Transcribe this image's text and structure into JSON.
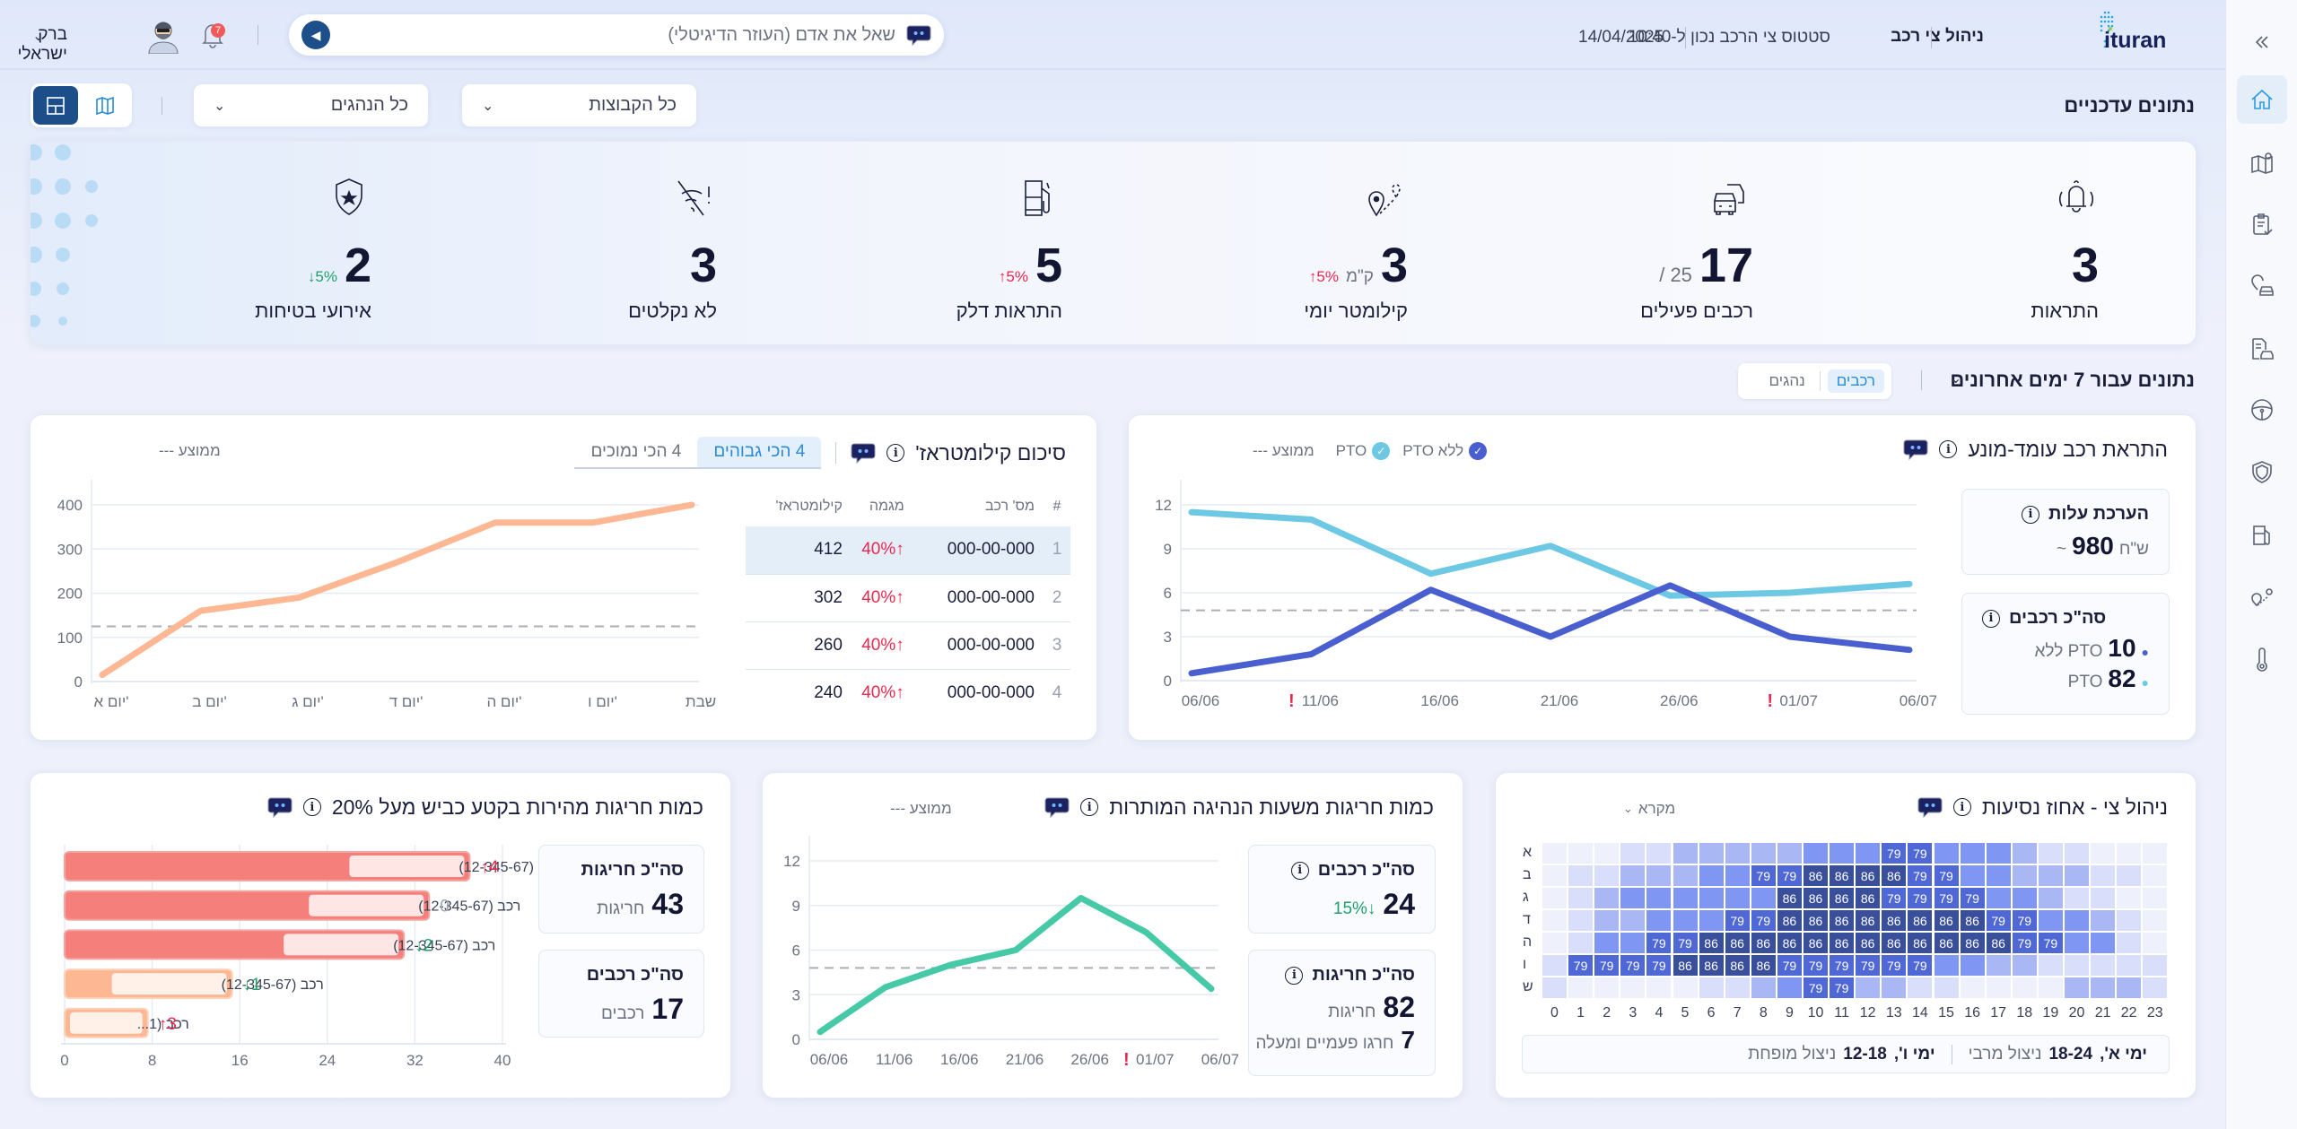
{
  "header": {
    "brand": "ituran",
    "app_title": "ניהול צי רכב",
    "status_text": "סטטוס צי הרכב נכון ל-10:40",
    "date": "14/04/2025",
    "search_placeholder": "שאל את אדם (העוזר הדיגיטלי)",
    "user_name": "ברק ישראלי",
    "notifications_count": "7"
  },
  "sidebar": {
    "items": [
      {
        "id": "collapse",
        "icon": "chevrons-left-icon"
      },
      {
        "id": "home",
        "icon": "home-icon",
        "active": true
      },
      {
        "id": "map",
        "icon": "map-pin-icon"
      },
      {
        "id": "reports",
        "icon": "clipboard-check-icon"
      },
      {
        "id": "vehicle-location",
        "icon": "car-location-icon"
      },
      {
        "id": "vehicle-docs",
        "icon": "car-document-icon"
      },
      {
        "id": "driving",
        "icon": "steering-wheel-icon"
      },
      {
        "id": "safety",
        "icon": "shield-icon"
      },
      {
        "id": "fuel",
        "icon": "fuel-pump-icon"
      },
      {
        "id": "routes",
        "icon": "route-icon"
      },
      {
        "id": "temperature",
        "icon": "thermometer-icon"
      }
    ]
  },
  "filters": {
    "section_title": "נתונים עדכניים",
    "groups": "כל הקבוצות",
    "drivers": "כל הנהגים",
    "view_modes": [
      "map",
      "dashboard"
    ],
    "active_view": "dashboard"
  },
  "kpis": [
    {
      "label": "התראות",
      "value": "3",
      "icon": "bell-icon"
    },
    {
      "label": "רכבים פעילים",
      "value": "17",
      "sub": "/ 25",
      "icon": "cars-icon"
    },
    {
      "label": "קילומטר יומי",
      "value": "3",
      "unit": "ק\"מ",
      "trend": "↑5%",
      "trend_dir": "up",
      "icon": "route-pin-icon"
    },
    {
      "label": "התראות דלק",
      "value": "5",
      "trend": "↑5%",
      "trend_dir": "up",
      "icon": "fuel-pump-icon"
    },
    {
      "label": "לא נקלטים",
      "value": "3",
      "icon": "no-signal-icon"
    },
    {
      "label": "אירועי בטיחות",
      "value": "2",
      "trend": "↓5%",
      "trend_dir": "down",
      "icon": "shield-star-icon"
    }
  ],
  "period": {
    "title": "נתונים עבור 7 ימים אחרונים",
    "tabs": [
      "רכבים",
      "נהגים"
    ],
    "active_tab": "רכבים"
  },
  "mileage": {
    "title": "סיכום קילומטראז'",
    "tabs": [
      "4 הכי גבוהים",
      "4 הכי נמוכים"
    ],
    "active_tab": "4 הכי גבוהים",
    "avg_label": "ממוצע ---",
    "table": {
      "headers": [
        "#",
        "מס' רכב",
        "מגמה",
        "קילומטראז'"
      ],
      "rows": [
        {
          "rank": "1",
          "plate": "000-00-000",
          "trend": "↑40%",
          "km": "412"
        },
        {
          "rank": "2",
          "plate": "000-00-000",
          "trend": "↑40%",
          "km": "302"
        },
        {
          "rank": "3",
          "plate": "000-00-000",
          "trend": "↑40%",
          "km": "260"
        },
        {
          "rank": "4",
          "plate": "000-00-000",
          "trend": "↑40%",
          "km": "240"
        }
      ]
    },
    "chart_data": {
      "type": "line",
      "categories": [
        "יום א'",
        "יום ב'",
        "יום ג'",
        "יום ד'",
        "יום ה'",
        "יום ו'",
        "שבת"
      ],
      "values": [
        15,
        160,
        190,
        270,
        360,
        360,
        400
      ],
      "average": 125,
      "ylim": [
        0,
        400
      ],
      "yticks": [
        0,
        100,
        200,
        300,
        400
      ],
      "color": "#fdb893",
      "grid": true
    }
  },
  "idle": {
    "title": "התראת רכב עומד-מונע",
    "legend": [
      {
        "label": "ללא PTO",
        "color": "#4a5fcf"
      },
      {
        "label": "PTO",
        "color": "#6cc8e3"
      }
    ],
    "avg_label": "ממוצע ---",
    "cost": {
      "title": "הערכת עלות",
      "prefix": "~",
      "value": "980",
      "unit": "ש\"ח"
    },
    "vehicles": {
      "title": "סה\"כ רכבים",
      "rows": [
        {
          "value": "10",
          "label": "ללא PTO"
        },
        {
          "value": "82",
          "label": "PTO"
        }
      ]
    },
    "chart_data": {
      "type": "line",
      "categories": [
        "06/06",
        "11/06",
        "16/06",
        "21/06",
        "26/06",
        "01/07",
        "06/07"
      ],
      "alerts": [
        "11/06",
        "01/07"
      ],
      "series": [
        {
          "name": "ללא PTO",
          "color": "#4a5fcf",
          "values": [
            0.5,
            1.8,
            6.2,
            3.0,
            6.5,
            3.0,
            2.1
          ]
        },
        {
          "name": "PTO",
          "color": "#6cc8e3",
          "values": [
            11.5,
            11.0,
            7.3,
            9.2,
            5.8,
            6.0,
            6.6
          ]
        }
      ],
      "average": 4.8,
      "ylim": [
        0,
        12
      ],
      "yticks": [
        0,
        3,
        6,
        9,
        12
      ],
      "grid": true
    }
  },
  "speeding": {
    "title": "כמות חריגות מהירות בקטע כביש מעל 20%",
    "total_violations": {
      "title": "סה\"כ חריגות",
      "value": "43",
      "unit": "חריגות"
    },
    "total_vehicles": {
      "title": "סה\"כ רכבים",
      "value": "17",
      "unit": "רכבים"
    },
    "chart_data": {
      "type": "bar",
      "orientation": "horizontal",
      "categories": [
        "רכב (12-345-67)",
        "רכב (12-345-67)",
        "רכב (12-345-67)",
        "רכב (12-345-67)",
        "רכב (1..."
      ],
      "values": [
        37,
        33.3,
        31,
        15.3,
        7.6
      ],
      "changes": [
        {
          "text": "↑4",
          "dir": "up"
        },
        {
          "text": "0",
          "dir": "zero"
        },
        {
          "text": "↓2",
          "dir": "down"
        },
        {
          "text": "↓1",
          "dir": "down"
        },
        {
          "text": "↑3",
          "dir": "up"
        }
      ],
      "colors": [
        "#f47f7b",
        "#f47f7b",
        "#f47f7b",
        "#fdb893",
        "#fdb893"
      ],
      "xlim": [
        0,
        40
      ],
      "xticks": [
        0,
        8,
        16,
        24,
        32,
        40
      ]
    }
  },
  "hours": {
    "title": "כמות חריגות משעות הנהיגה המותרות",
    "avg_label": "ממוצע ---",
    "vehicles": {
      "title": "סה\"כ רכבים",
      "value": "24",
      "trend": "↓15%"
    },
    "violations": {
      "title": "סה\"כ חריגות",
      "value": "82",
      "unit": "חריגות",
      "repeat_value": "7",
      "repeat_label": "חרגו פעמיים ומעלה"
    },
    "chart_data": {
      "type": "line",
      "categories": [
        "06/06",
        "11/06",
        "16/06",
        "21/06",
        "26/06",
        "01/07",
        "06/07"
      ],
      "alerts": [
        "01/07"
      ],
      "values": [
        0.5,
        3.5,
        5.0,
        6.0,
        9.5,
        7.2,
        3.4
      ],
      "color": "#45c9a6",
      "average": 4.8,
      "ylim": [
        0,
        12
      ],
      "yticks": [
        0,
        3,
        6,
        9,
        12
      ],
      "grid": true
    }
  },
  "utilization": {
    "title": "ניהול צי - אחוז נסיעות",
    "legend_label": "מקרא",
    "summary": {
      "max_days": "ימי א',",
      "max_hours": "18-24",
      "max_label": "ניצול מרבי",
      "min_days": "ימי ו',",
      "min_hours": "12-18",
      "min_label": "ניצול מופחת"
    },
    "chart_data": {
      "type": "heatmap",
      "hours": [
        "0",
        "1",
        "2",
        "3",
        "4",
        "5",
        "6",
        "7",
        "8",
        "9",
        "10",
        "11",
        "12",
        "13",
        "14",
        "15",
        "16",
        "17",
        "18",
        "19",
        "20",
        "21",
        "22",
        "23"
      ],
      "rows": [
        {
          "day": "א",
          "intensity": [
            0,
            0,
            0,
            1,
            1,
            2,
            2,
            2,
            2,
            2,
            3,
            3,
            3,
            4,
            4,
            3,
            3,
            3,
            2,
            1,
            1,
            0,
            0,
            0
          ],
          "values": [
            null,
            null,
            null,
            null,
            null,
            null,
            null,
            null,
            null,
            null,
            null,
            null,
            null,
            79,
            79,
            null,
            null,
            null,
            null,
            null,
            null,
            null,
            null,
            null
          ]
        },
        {
          "day": "ב",
          "intensity": [
            0,
            1,
            1,
            2,
            2,
            2,
            3,
            3,
            4,
            4,
            5,
            5,
            5,
            5,
            4,
            4,
            3,
            3,
            2,
            2,
            2,
            1,
            1,
            0
          ],
          "values": [
            null,
            null,
            null,
            null,
            null,
            null,
            null,
            null,
            79,
            79,
            86,
            86,
            86,
            86,
            79,
            79,
            null,
            null,
            null,
            null,
            null,
            null,
            null,
            null
          ]
        },
        {
          "day": "ג",
          "intensity": [
            0,
            1,
            2,
            3,
            3,
            3,
            3,
            3,
            3,
            5,
            5,
            5,
            5,
            4,
            4,
            4,
            4,
            3,
            3,
            2,
            1,
            1,
            0,
            0
          ],
          "values": [
            null,
            null,
            null,
            null,
            null,
            null,
            null,
            null,
            null,
            86,
            86,
            86,
            86,
            79,
            79,
            79,
            79,
            null,
            null,
            null,
            null,
            null,
            null,
            null
          ]
        },
        {
          "day": "ד",
          "intensity": [
            0,
            1,
            2,
            2,
            3,
            3,
            3,
            4,
            4,
            5,
            5,
            5,
            5,
            5,
            5,
            5,
            5,
            4,
            4,
            3,
            3,
            2,
            1,
            0
          ],
          "values": [
            null,
            null,
            null,
            null,
            null,
            null,
            null,
            79,
            79,
            86,
            86,
            86,
            86,
            86,
            86,
            86,
            86,
            79,
            79,
            null,
            null,
            null,
            null,
            null
          ]
        },
        {
          "day": "ה",
          "intensity": [
            0,
            1,
            3,
            3,
            4,
            4,
            5,
            5,
            5,
            5,
            5,
            5,
            5,
            5,
            5,
            5,
            5,
            5,
            4,
            4,
            3,
            3,
            1,
            0
          ],
          "values": [
            null,
            null,
            null,
            null,
            79,
            79,
            86,
            86,
            86,
            86,
            86,
            86,
            86,
            86,
            86,
            86,
            86,
            86,
            79,
            79,
            null,
            null,
            null,
            null
          ]
        },
        {
          "day": "ו",
          "intensity": [
            1,
            4,
            4,
            4,
            4,
            5,
            5,
            5,
            5,
            4,
            4,
            4,
            4,
            4,
            4,
            3,
            3,
            2,
            2,
            1,
            1,
            1,
            1,
            1
          ],
          "values": [
            null,
            79,
            79,
            79,
            79,
            86,
            86,
            86,
            86,
            79,
            79,
            79,
            79,
            79,
            79,
            null,
            null,
            null,
            null,
            null,
            null,
            null,
            null,
            null
          ]
        },
        {
          "day": "ש",
          "intensity": [
            1,
            0,
            0,
            0,
            0,
            0,
            1,
            1,
            2,
            3,
            4,
            4,
            2,
            2,
            1,
            1,
            0,
            0,
            0,
            0,
            2,
            2,
            2,
            1
          ],
          "values": [
            null,
            null,
            null,
            null,
            null,
            null,
            null,
            null,
            null,
            null,
            79,
            79,
            null,
            null,
            null,
            null,
            null,
            null,
            null,
            null,
            null,
            null,
            null,
            null
          ]
        }
      ],
      "colors": [
        "#eef1fb",
        "#d9defa",
        "#aab7f5",
        "#7f97f2",
        "#4f68d6",
        "#3a4f9c"
      ]
    }
  }
}
